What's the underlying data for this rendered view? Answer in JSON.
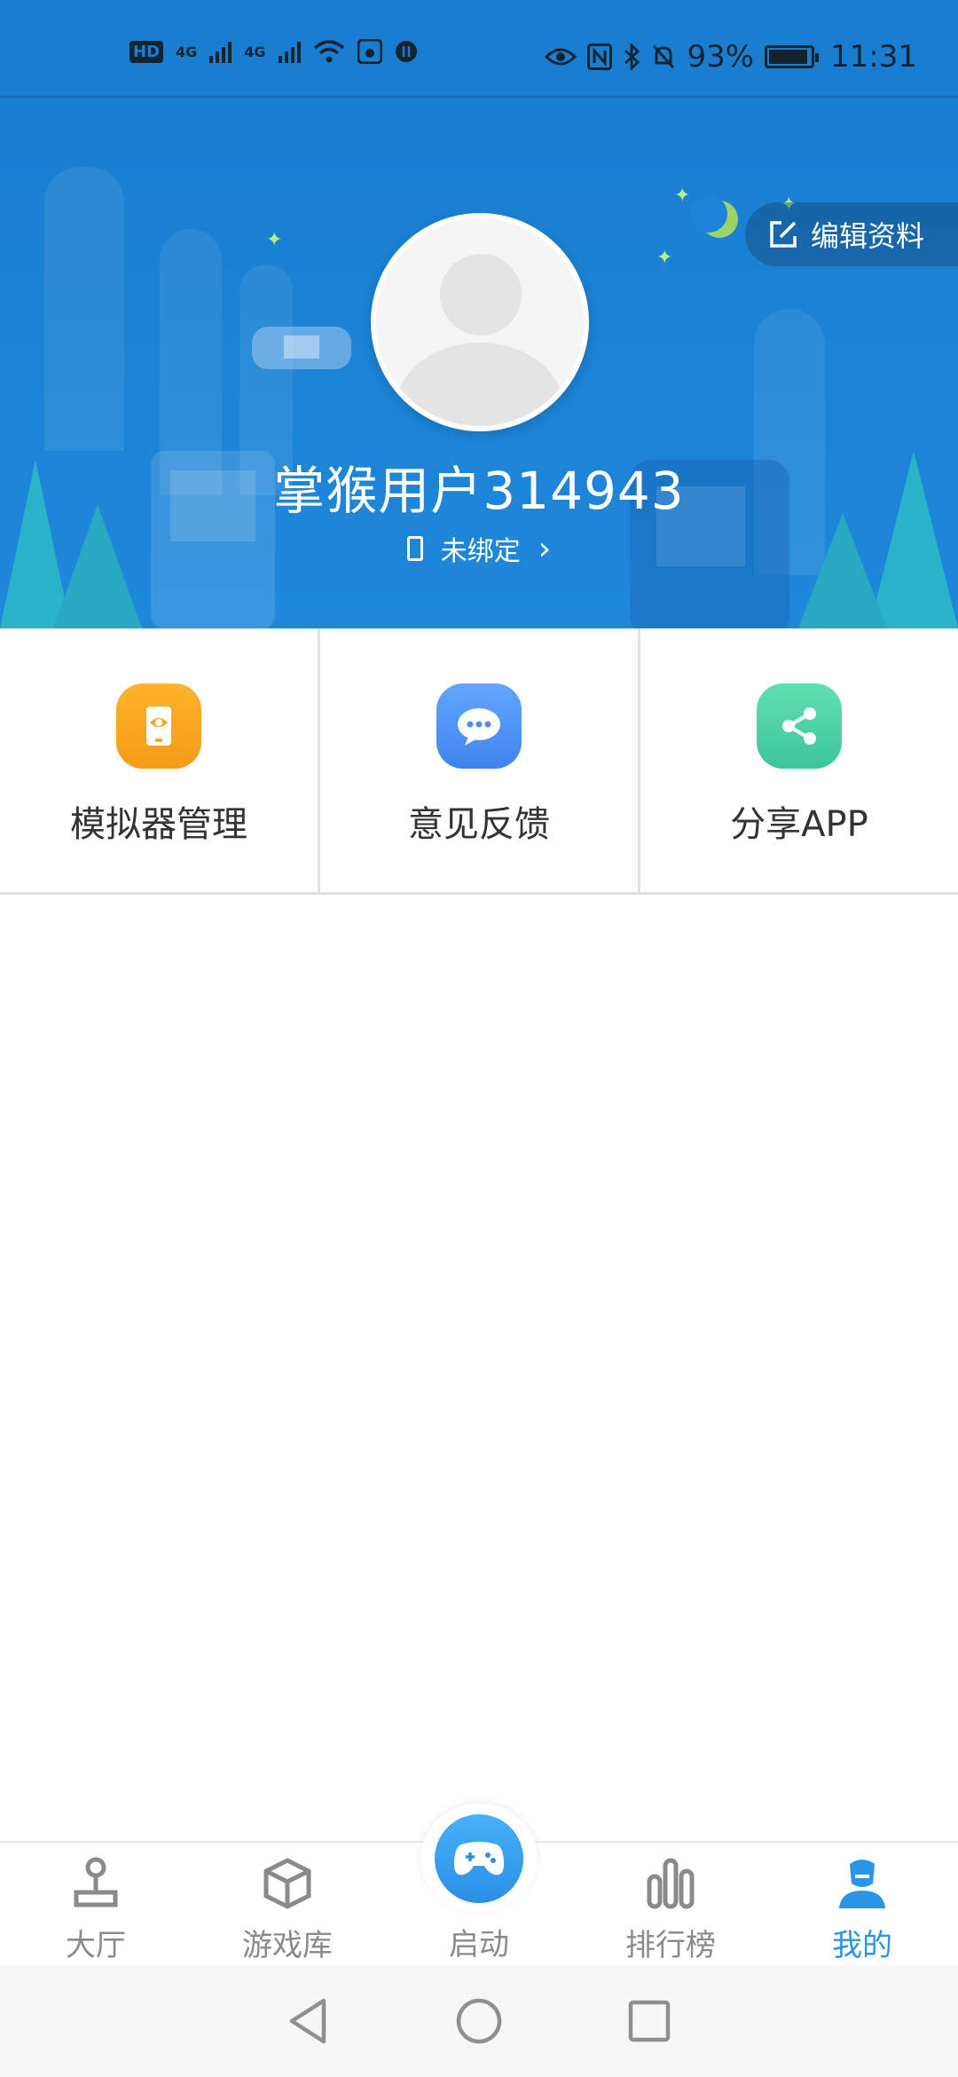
{
  "status_bar": {
    "hd_label": "HD",
    "net1": "4G",
    "net2": "4G",
    "battery_percent": "93%",
    "time": "11:31"
  },
  "header": {
    "edit_profile_label": "编辑资料",
    "username": "掌猴用户314943",
    "bind_status": "未绑定"
  },
  "actions": [
    {
      "label": "模拟器管理",
      "icon": "emulator-manage-icon",
      "color": "#f6a41c"
    },
    {
      "label": "意见反馈",
      "icon": "feedback-icon",
      "color": "#4a8ff0"
    },
    {
      "label": "分享APP",
      "icon": "share-icon",
      "color": "#45cca0"
    }
  ],
  "tabs": {
    "hall": "大厅",
    "library": "游戏库",
    "launch": "启动",
    "ranking": "排行榜",
    "mine": "我的",
    "active": "我的",
    "accent": "#2a95e6"
  }
}
